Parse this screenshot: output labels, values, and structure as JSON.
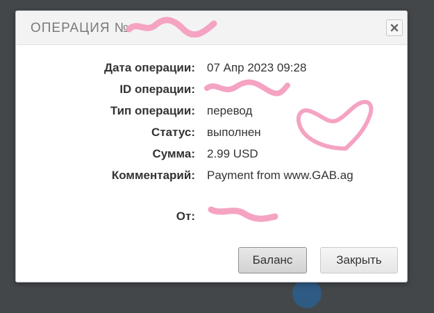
{
  "dialog": {
    "title": "ОПЕРАЦИЯ №",
    "close_icon": "close-icon"
  },
  "details": [
    {
      "label": "Дата операции:",
      "value": "07 Апр 2023 09:28"
    },
    {
      "label": "ID операции:",
      "value": ""
    },
    {
      "label": "Тип операции:",
      "value": "перевод"
    },
    {
      "label": "Статус:",
      "value": "выполнен"
    },
    {
      "label": "Сумма:",
      "value": "2.99 USD"
    },
    {
      "label": "Комментарий:",
      "value": "Payment from www.GAB.ag"
    }
  ],
  "from": {
    "label": "От:",
    "value": ""
  },
  "buttons": {
    "balance": "Баланс",
    "close": "Закрыть"
  },
  "colors": {
    "overlay": "#43474a",
    "scribble": "#f5a3c3",
    "accent_circle": "#2f5a83"
  }
}
